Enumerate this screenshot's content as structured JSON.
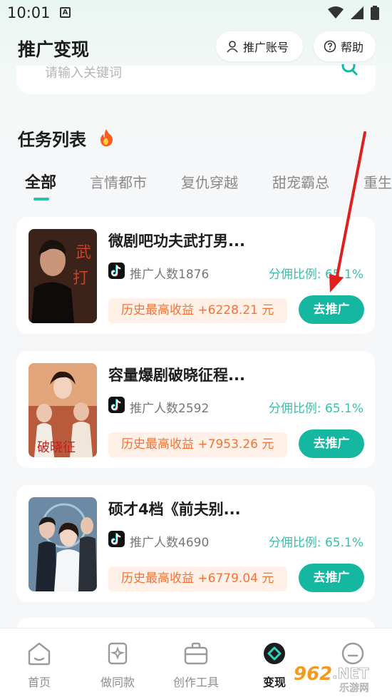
{
  "status_bar": {
    "time": "10:01",
    "notification_glyph": "A"
  },
  "header": {
    "title": "推广变现",
    "account_button": "推广账号",
    "help_button": "帮助"
  },
  "search": {
    "placeholder": "请输入关键词"
  },
  "section": {
    "title": "任务列表"
  },
  "tabs": [
    {
      "label": "全部",
      "active": true
    },
    {
      "label": "言情都市"
    },
    {
      "label": "复仇穿越"
    },
    {
      "label": "甜宠霸总"
    },
    {
      "label": "重生"
    }
  ],
  "cards": [
    {
      "title": "微剧吧功夫武打男...",
      "promoters": "推广人数1876",
      "ratio": "分佣比例: 65.1%",
      "earnings": "历史最高收益 +6228.21 元",
      "button": "去推广"
    },
    {
      "title": "容量爆剧破晓征程...",
      "promoters": "推广人数2592",
      "ratio": "分佣比例: 65.1%",
      "earnings": "历史最高收益 +7953.26 元",
      "button": "去推广"
    },
    {
      "title": "硕才4档《前夫别...",
      "promoters": "推广人数4690",
      "ratio": "分佣比例: 65.1%",
      "earnings": "历史最高收益 +6779.04 元",
      "button": "去推广"
    }
  ],
  "bottom_nav": [
    {
      "label": "首页",
      "icon": "home-icon"
    },
    {
      "label": "做同款",
      "icon": "template-icon"
    },
    {
      "label": "创作工具",
      "icon": "toolbox-icon"
    },
    {
      "label": "变现",
      "icon": "monetize-icon",
      "active": true
    },
    {
      "label": "",
      "icon": "profile-icon"
    }
  ],
  "watermark": {
    "number": "962",
    "suffix": ".NET",
    "caption": "乐游网"
  },
  "colors": {
    "accent": "#16b7a0",
    "earnings_text": "#f0743a",
    "earnings_bg": "#fff1e8",
    "annotation": "#e0201e"
  }
}
